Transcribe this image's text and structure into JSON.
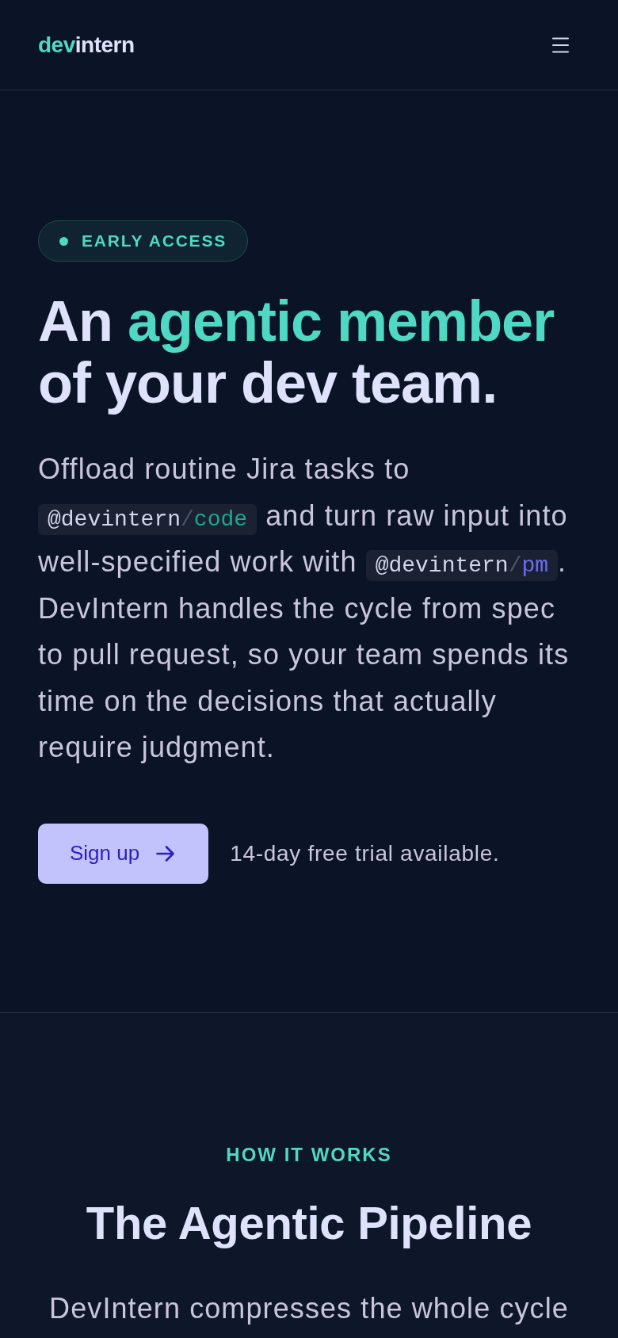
{
  "header": {
    "logo": {
      "accent": "dev",
      "rest": "intern"
    }
  },
  "hero": {
    "badge": {
      "label": "EARLY ACCESS"
    },
    "heading": [
      {
        "text": "An ",
        "accent": false
      },
      {
        "text": "agentic member",
        "accent": true
      },
      {
        "text": " of your dev team.",
        "accent": false
      }
    ],
    "description": [
      {
        "kind": "text",
        "text": "Offload routine Jira tasks to "
      },
      {
        "kind": "mention",
        "scope": "@devintern",
        "separator": "/",
        "agent": "code",
        "color": "#1fa78d"
      },
      {
        "kind": "text",
        "text": " and turn raw input into well-specified work with "
      },
      {
        "kind": "mention",
        "scope": "@devintern",
        "separator": "/",
        "agent": "pm",
        "color": "#6b6cf6"
      },
      {
        "kind": "text",
        "text": ". DevIntern handles the cycle from spec to pull request, so your team spends its time on the decisions that actually require judgment."
      }
    ],
    "cta": {
      "label": "Sign up"
    },
    "note": "14-day free trial available."
  },
  "how_it_works": {
    "eyebrow": "HOW IT WORKS",
    "title": "The Agentic Pipeline",
    "description": "DevIntern compresses the whole cycle"
  }
}
